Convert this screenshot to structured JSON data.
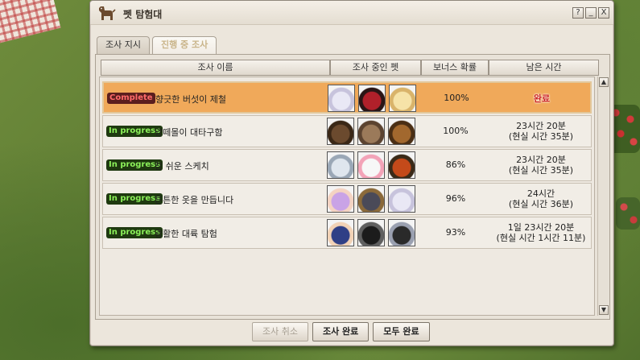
{
  "window": {
    "title": "펫 탐험대",
    "icon": "dog-icon",
    "buttons": [
      "?",
      "_",
      "X"
    ]
  },
  "tabs": [
    {
      "label": "조사 지시",
      "active": false
    },
    {
      "label": "진행 중 조사",
      "active": true
    }
  ],
  "columns": [
    "조사 이름",
    "조사 중인 펫",
    "보너스 확률",
    "남은 시간"
  ],
  "rows": [
    {
      "status": "Complete",
      "status_type": "complete",
      "name": "향긋한 버섯이 제철",
      "pets": [
        "white-ghost-pet-icon",
        "red-hair-girl-pet-icon",
        "blonde-doll-pet-icon"
      ],
      "bonus": "100%",
      "time_line1": "완료",
      "time_line2": "",
      "selected": true
    },
    {
      "status": "In progress",
      "status_type": "progress",
      "name": "양떼몰이 대타구함",
      "pets": [
        "brown-horse-pet-icon",
        "cat-hood-pet-icon",
        "pony-pet-icon"
      ],
      "bonus": "100%",
      "time_line1": "23시간 20분",
      "time_line2": "(현실 시간 35분)",
      "selected": false
    },
    {
      "status": "In progress",
      "status_type": "progress",
      "name": "참 쉬운 스케치",
      "pets": [
        "white-wolf-pet-icon",
        "flower-cat-pet-icon",
        "witch-hat-pet-icon"
      ],
      "bonus": "86%",
      "time_line1": "23시간 20분",
      "time_line2": "(현실 시간 35분)",
      "selected": false
    },
    {
      "status": "In progress",
      "status_type": "progress",
      "name": "튼튼한 옷을 만듭니다",
      "pets": [
        "purple-hair-girl-pet-icon",
        "broom-pet-icon",
        "white-ghost-pet-icon"
      ],
      "bonus": "96%",
      "time_line1": "24시간",
      "time_line2": "(현실 시간 36분)",
      "selected": false
    },
    {
      "status": "In progress",
      "status_type": "progress",
      "name": "광활한 대륙 탐험",
      "pets": [
        "blue-hat-kid-pet-icon",
        "black-horse-pet-icon",
        "unicorn-pet-icon"
      ],
      "bonus": "93%",
      "time_line1": "1일 23시간 20분",
      "time_line2": "(현실 시간 1시간 11분)",
      "selected": false
    }
  ],
  "footer": {
    "cancel_label": "조사 취소",
    "complete_label": "조사 완료",
    "complete_all_label": "모두 완료"
  }
}
